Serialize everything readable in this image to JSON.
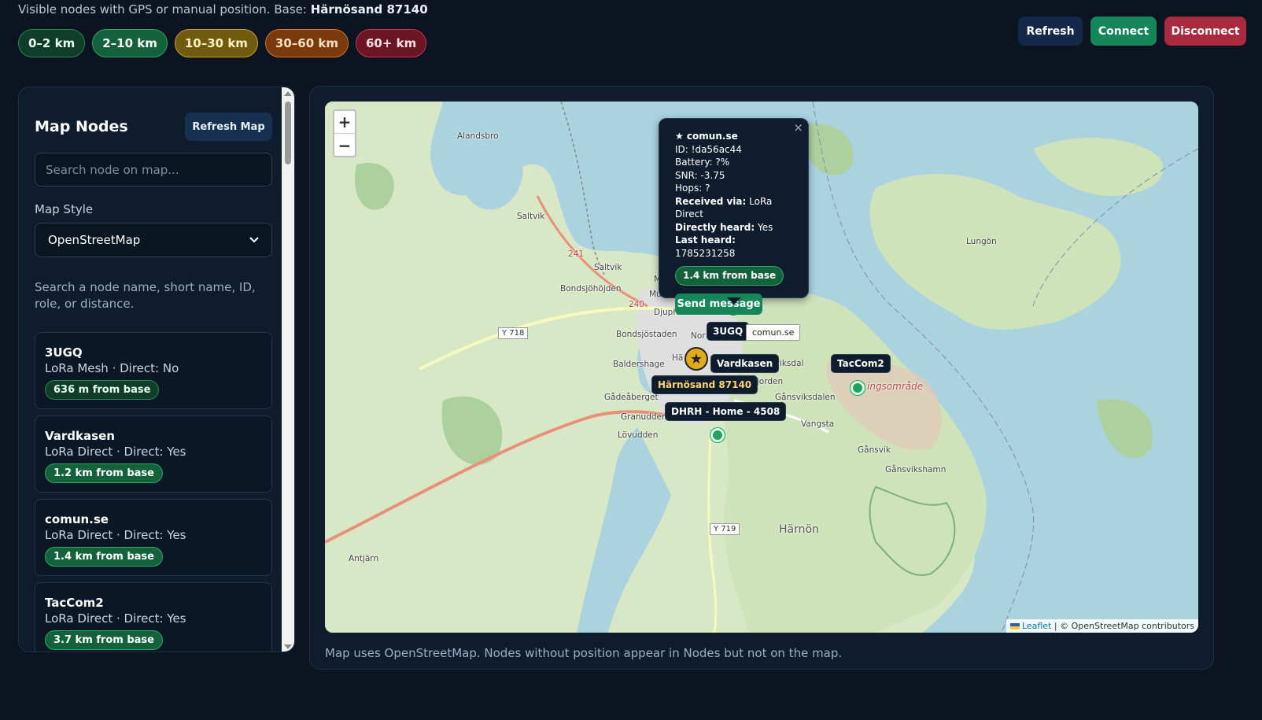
{
  "header": {
    "visible_prefix": "Visible nodes with GPS or manual position. Base:",
    "base_name": "Härnösand 87140"
  },
  "distance_chips": [
    "0–2 km",
    "2–10 km",
    "10–30 km",
    "30–60 km",
    "60+ km"
  ],
  "top_buttons": {
    "refresh": "Refresh",
    "connect": "Connect",
    "disconnect": "Disconnect"
  },
  "sidebar": {
    "title": "Map Nodes",
    "refresh_map": "Refresh Map",
    "search_placeholder": "Search node on map...",
    "map_style_label": "Map Style",
    "map_style_value": "OpenStreetMap",
    "hint": "Search a node name, short name, ID, role, or distance.",
    "nodes": [
      {
        "name": "3UGQ",
        "sub": "LoRa Mesh · Direct: No",
        "distance": "636 m from base"
      },
      {
        "name": "Vardkasen",
        "sub": "LoRa Direct · Direct: Yes",
        "distance": "1.2 km from base"
      },
      {
        "name": "comun.se",
        "sub": "LoRa Direct · Direct: Yes",
        "distance": "1.4 km from base"
      },
      {
        "name": "TacCom2",
        "sub": "LoRa Direct · Direct: Yes",
        "distance": "3.7 km from base"
      }
    ]
  },
  "map": {
    "zoom_in": "+",
    "zoom_out": "−",
    "place_labels": {
      "alandsbro": "Alandsbro",
      "saltvik": "Saltvik",
      "saltvik2": "Saltvik",
      "bondsjohojden": "Bondsjöhöjden",
      "djuphamn": "Djuphamnsområde",
      "bondsjostaden": "Bondsjöstaden",
      "baldershage": "Baldershage",
      "gadeaberget": "Gådeåberget",
      "granudden": "Granudden",
      "lovudden": "Lövudden",
      "eriksdal": "Eriksdal",
      "astjorden": "Östjorden",
      "gansviksdalen": "Gånsviksdalen",
      "vangsta": "Vangsta",
      "gansvik": "Gånsvik",
      "gansvikshamn": "Gånsvikshamn",
      "harnon": "Härnön",
      "lungon": "Lungön",
      "antjarn": "Antjärn",
      "ingsomrade": "ingsområde",
      "ha": "Hä",
      "nor": "Nor",
      "mu": "Mu",
      "m": "M"
    },
    "road_numbers": {
      "r241": "241",
      "r240": "240",
      "y718": "Y 718",
      "y719": "Y 719"
    },
    "node_tags": {
      "ugq": "3UGQ",
      "vardkasen": "Vardkasen",
      "taccom2": "TacCom2",
      "base": "Härnösand 87140",
      "dhrh": "DHRH - Home - 4508"
    },
    "hover_tooltip": "comun.se",
    "popup": {
      "close": "×",
      "title": "★ comun.se",
      "id": "ID: !da56ac44",
      "battery": "Battery: ?%",
      "snr": "SNR: -3.75",
      "hops": "Hops: ?",
      "received_label": "Received via:",
      "received_value": "LoRa Direct",
      "direct_label": "Directly heard:",
      "direct_value": "Yes",
      "lastheard_label": "Last heard:",
      "lastheard_value": "1785231258",
      "distance": "1.4 km from base",
      "send": "Send message"
    },
    "attribution_leaflet": "Leaflet",
    "attribution_rest": "| © OpenStreetMap contributors",
    "caption": "Map uses OpenStreetMap. Nodes without position appear in Nodes but not on the map."
  },
  "colors": {
    "background": "#0b1420",
    "panel": "#0f1c2e",
    "connect": "#14865a",
    "disconnect": "#a72a3f",
    "refresh": "#14294a",
    "node_marker": "#1fa35a",
    "base_marker": "#e0a91e",
    "water": "#aad3df",
    "land": "#d8e7c6"
  },
  "icons": {
    "base_marker": "star-icon",
    "zoom_in": "plus-icon",
    "zoom_out": "minus-icon",
    "select": "chevron-down-icon",
    "close": "close-icon"
  }
}
